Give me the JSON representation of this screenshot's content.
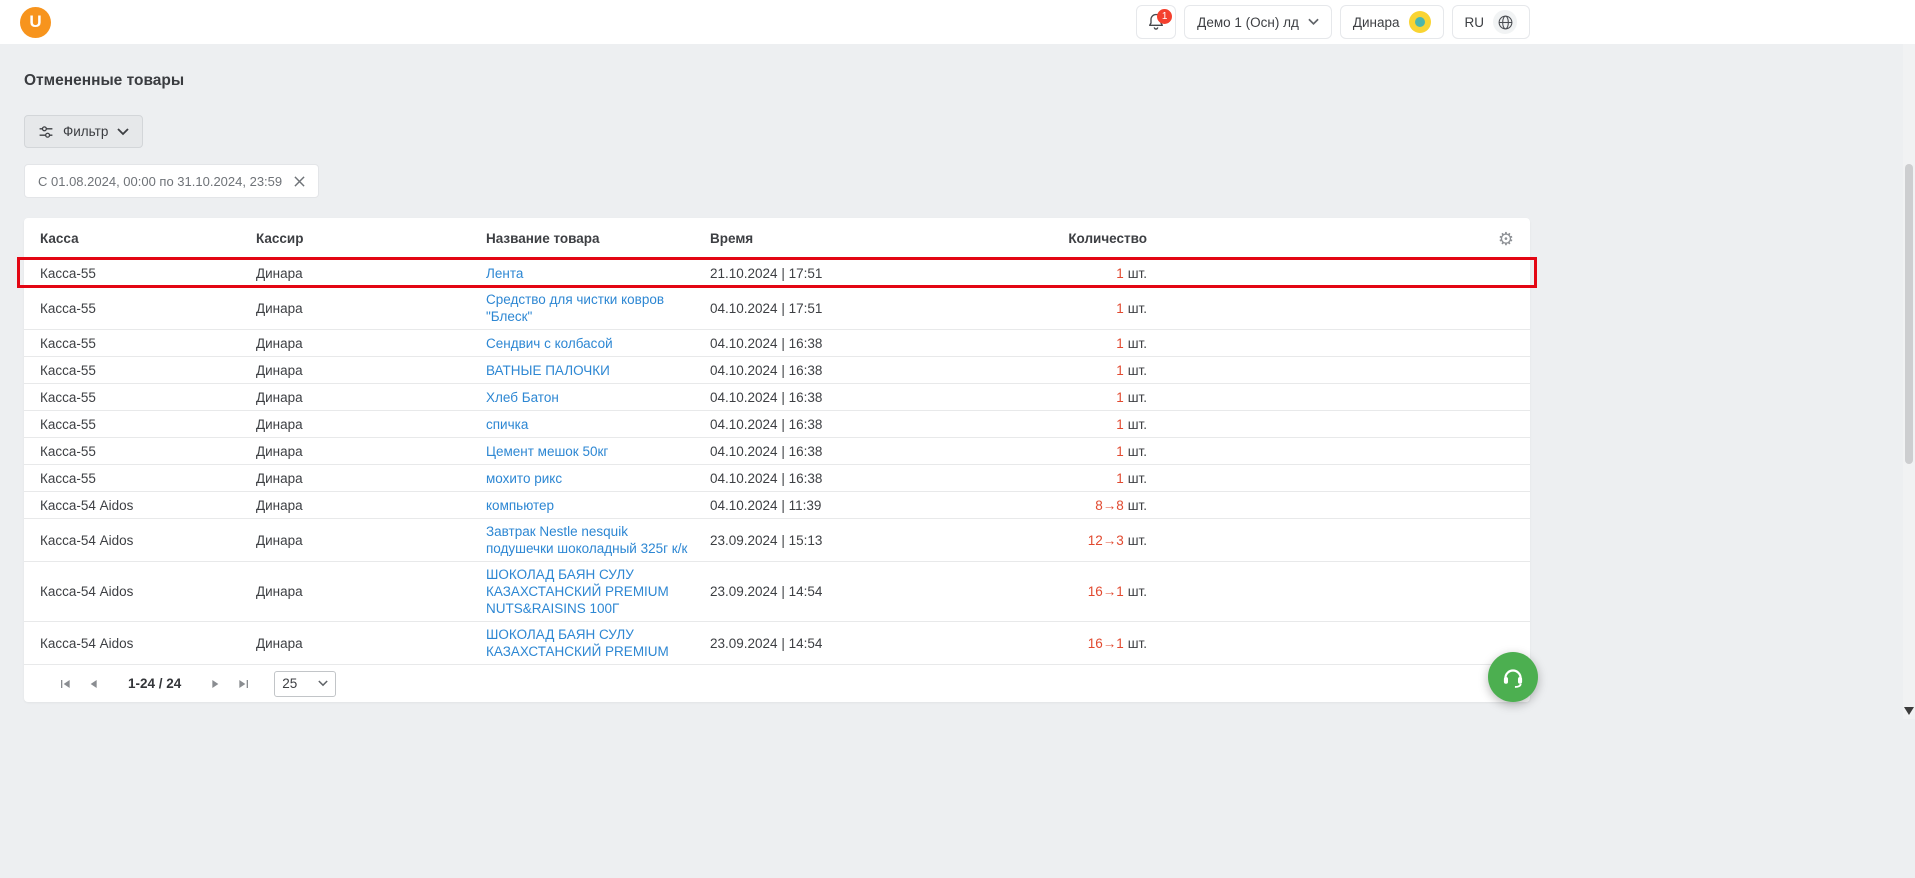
{
  "topbar": {
    "logo": "U",
    "notifications": {
      "badge": "1"
    },
    "branch_selector": {
      "label": "Демо 1 (Осн) лд"
    },
    "user": {
      "name": "Динара"
    },
    "language": {
      "code": "RU"
    }
  },
  "page": {
    "title": "Отмененные товары",
    "filter": {
      "button_label": "Фильтр",
      "active_filter": "С 01.08.2024, 00:00 по 31.10.2024, 23:59"
    }
  },
  "table": {
    "columns": {
      "kassa": "Касса",
      "cashier": "Кассир",
      "product": "Название товара",
      "time": "Время",
      "quantity": "Количество"
    },
    "highlighted_row": 0,
    "rows": [
      {
        "kassa": "Касса-55",
        "cashier": "Динара",
        "product": "Лента",
        "time": "21.10.2024 | 17:51",
        "qty": "1",
        "unit": "шт."
      },
      {
        "kassa": "Касса-55",
        "cashier": "Динара",
        "product": "Средство для чистки ковров \"Блеск\"",
        "time": "04.10.2024 | 17:51",
        "qty": "1",
        "unit": "шт."
      },
      {
        "kassa": "Касса-55",
        "cashier": "Динара",
        "product": "Сендвич с колбасой",
        "time": "04.10.2024 | 16:38",
        "qty": "1",
        "unit": "шт."
      },
      {
        "kassa": "Касса-55",
        "cashier": "Динара",
        "product": "ВАТНЫЕ ПАЛОЧКИ",
        "time": "04.10.2024 | 16:38",
        "qty": "1",
        "unit": "шт."
      },
      {
        "kassa": "Касса-55",
        "cashier": "Динара",
        "product": "Хлеб Батон",
        "time": "04.10.2024 | 16:38",
        "qty": "1",
        "unit": "шт."
      },
      {
        "kassa": "Касса-55",
        "cashier": "Динара",
        "product": "спичка",
        "time": "04.10.2024 | 16:38",
        "qty": "1",
        "unit": "шт."
      },
      {
        "kassa": "Касса-55",
        "cashier": "Динара",
        "product": "Цемент мешок 50кг",
        "time": "04.10.2024 | 16:38",
        "qty": "1",
        "unit": "шт."
      },
      {
        "kassa": "Касса-55",
        "cashier": "Динара",
        "product": "мохито рикс",
        "time": "04.10.2024 | 16:38",
        "qty": "1",
        "unit": "шт."
      },
      {
        "kassa": "Касса-54 Aidos",
        "cashier": "Динара",
        "product": "компьютер",
        "time": "04.10.2024 | 11:39",
        "qty": "8→8",
        "unit": "шт."
      },
      {
        "kassa": "Касса-54 Aidos",
        "cashier": "Динара",
        "product": "Завтрак Nestle nesquik подушечки шоколадный 325г к/к",
        "time": "23.09.2024 | 15:13",
        "qty": "12→3",
        "unit": "шт."
      },
      {
        "kassa": "Касса-54 Aidos",
        "cashier": "Динара",
        "product": "ШОКОЛАД БАЯН СУЛУ КАЗАХСТАНСКИЙ PREMIUM NUTS&RAISINS 100Г",
        "time": "23.09.2024 | 14:54",
        "qty": "16→1",
        "unit": "шт."
      },
      {
        "kassa": "Касса-54 Aidos",
        "cashier": "Динара",
        "product": "ШОКОЛАД БАЯН СУЛУ КАЗАХСТАНСКИЙ PREMIUM",
        "time": "23.09.2024 | 14:54",
        "qty": "16→1",
        "unit": "шт."
      }
    ]
  },
  "pagination": {
    "range_label": "1-24 / 24",
    "page_size": "25"
  },
  "colors": {
    "brand_orange": "#f7941d",
    "link_blue": "#2d87d3",
    "quantity_red": "#e1492f",
    "highlight_red": "#e30613",
    "badge_red": "#f4402e",
    "support_green": "#4caf50",
    "background_gray": "#edeff1"
  },
  "icons": {
    "topbar": [
      "bell-icon",
      "chevron-down-icon",
      "avatar",
      "globe-icon"
    ],
    "filter": "sliders-icon",
    "chip": "close-icon",
    "table": "gear-icon",
    "pagination": [
      "first-page-icon",
      "prev-page-icon",
      "next-page-icon",
      "last-page-icon"
    ],
    "support": "headset-icon"
  }
}
